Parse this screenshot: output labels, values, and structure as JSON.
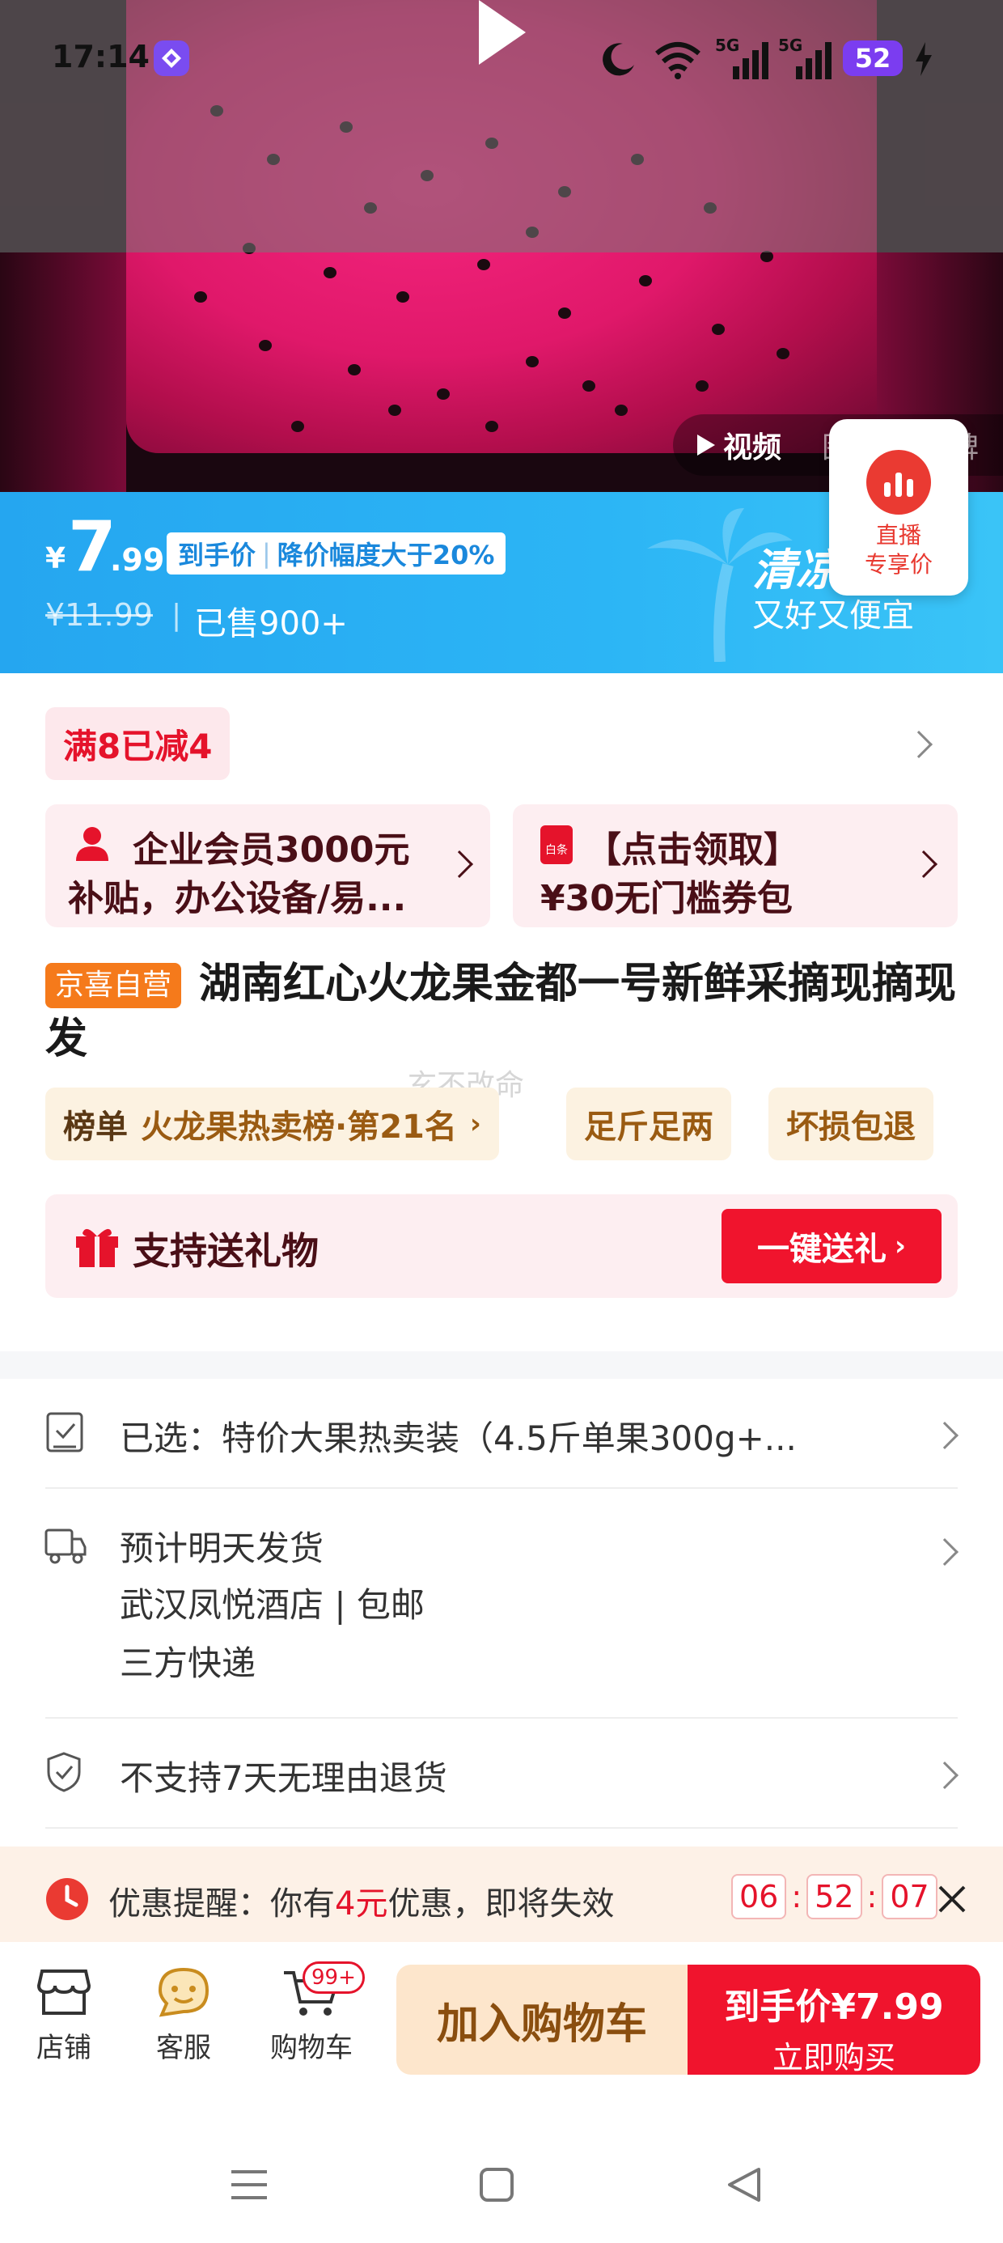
{
  "status_bar": {
    "time": "17:14",
    "battery": "52",
    "net1": "5G",
    "net2": "5G"
  },
  "media_tabs": {
    "video": "视频",
    "gallery": "图集",
    "reviews": "口碑"
  },
  "live_badge": {
    "line1": "直播",
    "line2": "专享价"
  },
  "price": {
    "currency": "¥",
    "integer": "7",
    "decimal": ".99",
    "tag_main": "到手价",
    "tag_sep": "|",
    "tag_detail": "降价幅度大于20%",
    "original": "¥11.99",
    "sold": "已售900+",
    "promo_title": "清凉",
    "promo_sub": "又好又便宜"
  },
  "discount_chip": "满8已减4",
  "coupon_left": {
    "line1": "企业会员3000元",
    "line2": "补贴，办公设备/易..."
  },
  "coupon_right": {
    "badge": "白条",
    "line1": "【点击领取】",
    "line2": "¥30无门槛券包"
  },
  "product": {
    "store_badge": "京喜自营",
    "title": "湖南红心火龙果金都一号新鲜采摘现摘现发",
    "watermark": "玄不改命"
  },
  "tags": {
    "rank_label": "榜单",
    "rank_text": "火龙果热卖榜·第21名",
    "tag2": "足斤足两",
    "tag3": "坏损包退"
  },
  "gift": {
    "label": "支持送礼物",
    "button": "一键送礼"
  },
  "selection": {
    "text": "已选：特价大果热卖装（4.5斤单果300g+..."
  },
  "shipping": {
    "line1": "预计明天发货",
    "line2": "武汉凤悦酒店 | 包邮",
    "line3": "三方快递"
  },
  "returns": {
    "text": "不支持7天无理由退货"
  },
  "reminder": {
    "prefix": "优惠提醒：你有",
    "amount": "4元",
    "suffix": "优惠，即将失效",
    "h": "06",
    "m": "52",
    "s": "07",
    "sep": ":"
  },
  "bottom_nav": {
    "store": "店铺",
    "service": "客服",
    "cart": "购物车",
    "cart_badge": "99+",
    "add_cart": "加入购物车",
    "buy_price_label": "到手价",
    "buy_price": "¥7.99",
    "buy_now": "立即购买"
  },
  "colors": {
    "accent_red": "#f0142d",
    "banner_blue": "#2cb0f4",
    "gold": "#8a5a1a"
  }
}
